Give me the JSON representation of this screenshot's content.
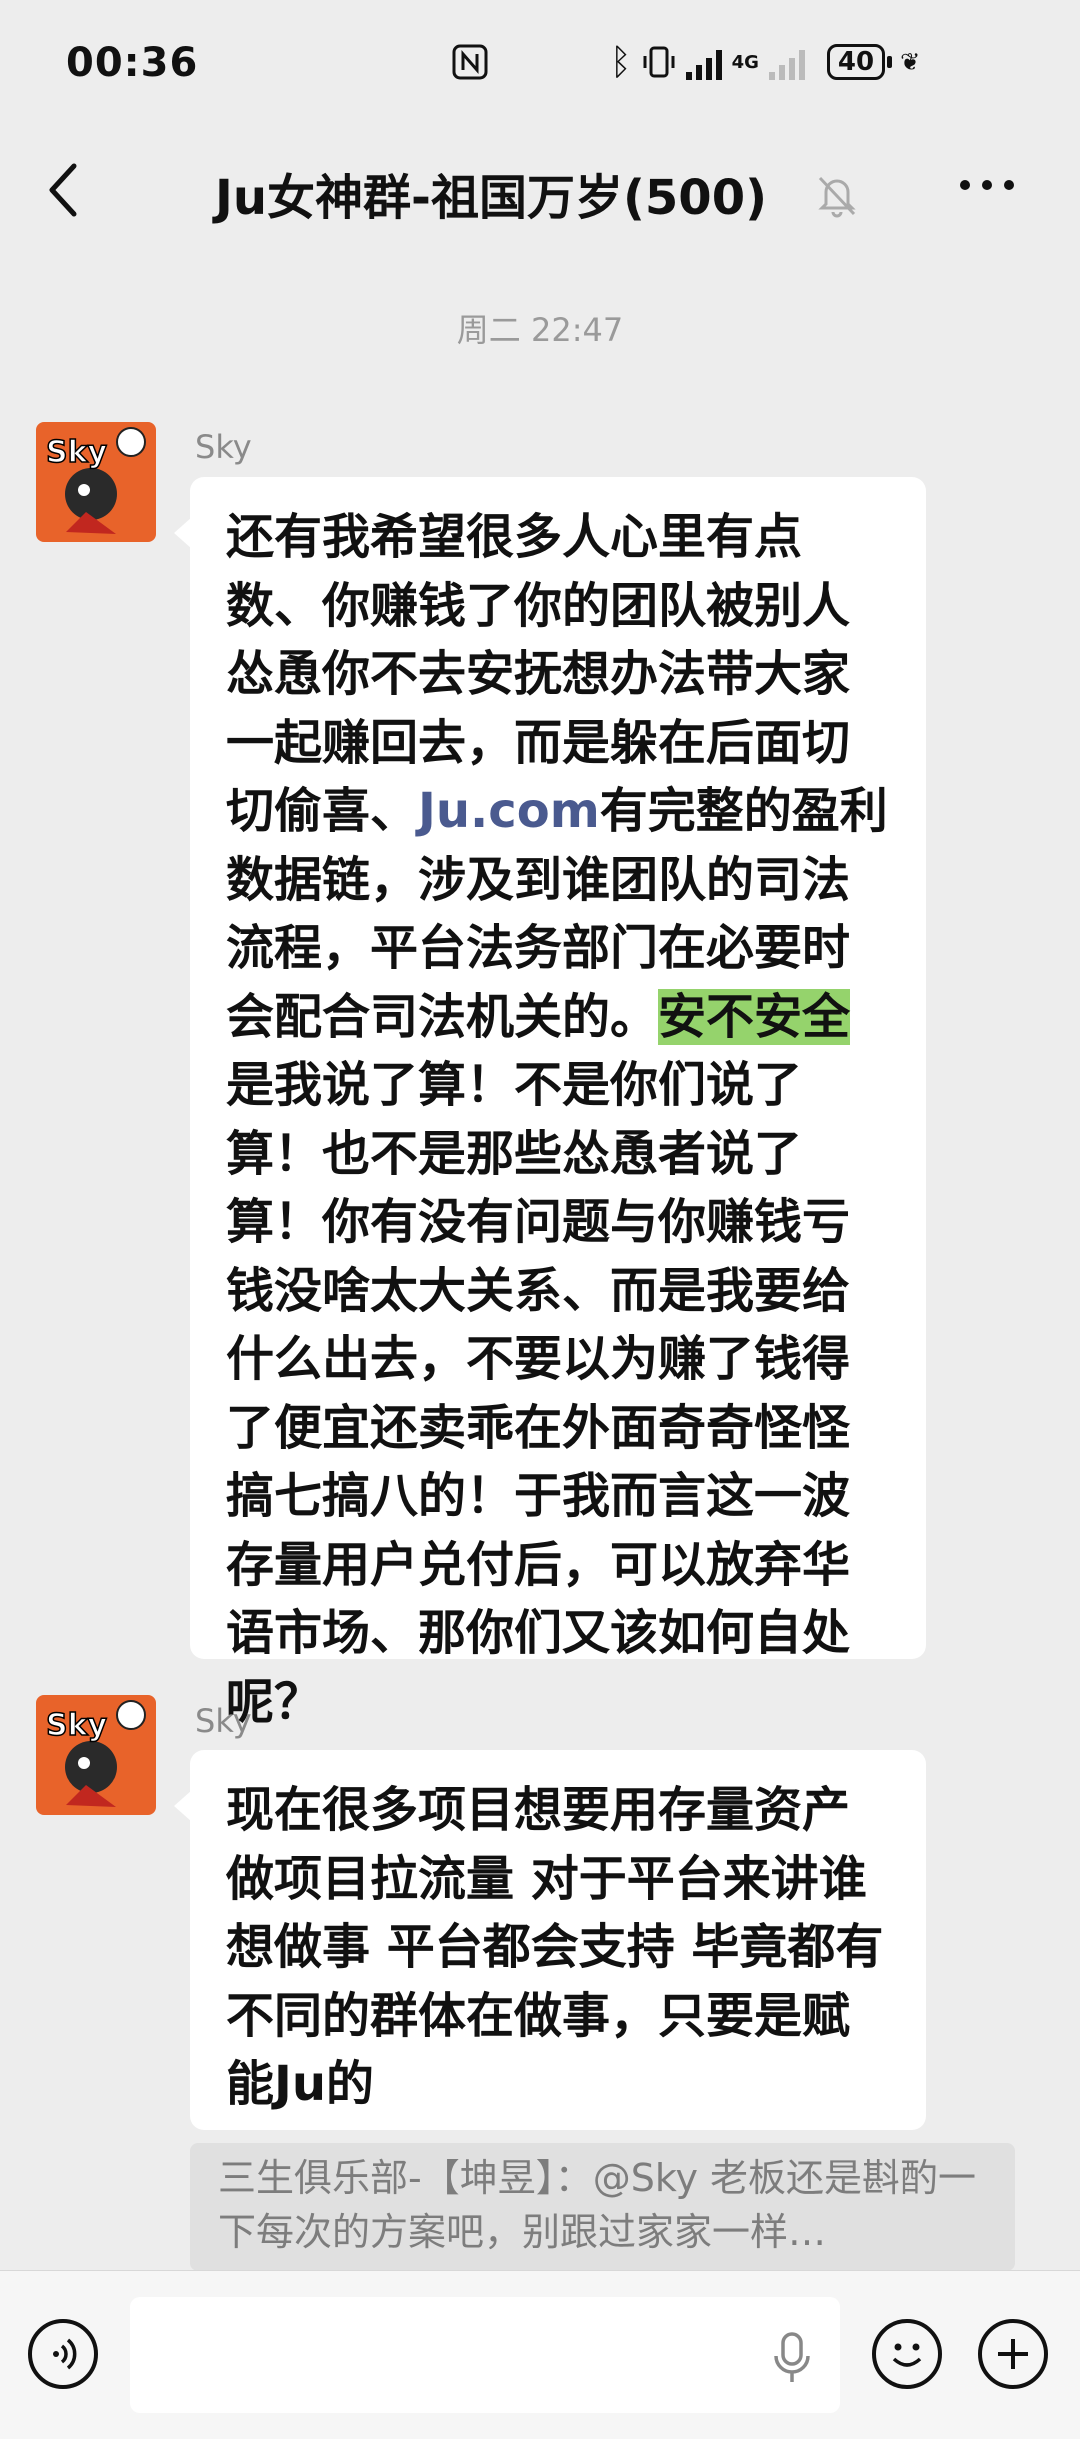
{
  "status_bar": {
    "time": "00:36",
    "network": "4G",
    "battery": "40"
  },
  "header": {
    "title": "Ju女神群-祖国万岁(500)"
  },
  "timestamp": "周二 22:47",
  "messages": [
    {
      "sender": "Sky",
      "avatar_icon": "sky-avatar",
      "text_1": "还有我希望很多人心里有点数、你赚钱了你的团队被别人怂恿你不去安抚想办法带大家一起赚回去，而是躲在后面切切偷喜、",
      "link": "Ju.com",
      "text_2": "有完整的盈利数据链，涉及到谁团队的司法流程，平台法务部门在必要时会配合司法机关的。",
      "highlight": "安不安全",
      "text_3": "是我说了算！不是你们说了算！也不是那些怂恿者说了算！你有没有问题与你赚钱亏钱没啥太大关系、而是我要给什么出去，不要以为赚了钱得了便宜还卖乖在外面奇奇怪怪搞七搞八的！于我而言这一波存量用户兑付后，可以放弃华语市场、那你们又该如何自处呢？"
    },
    {
      "sender": "Sky",
      "avatar_icon": "sky-avatar",
      "text": "现在很多项目想要用存量资产做项目拉流量 对于平台来讲谁想做事 平台都会支持 毕竟都有不同的群体在做事，只要是赋能Ju的"
    }
  ],
  "quoted_reply": "三生俱乐部-【坤昱】：@Sky 老板还是斟酌一下每次的方案吧，别跟过家家一样…",
  "colors": {
    "background": "#ededed",
    "bubble": "#ffffff",
    "highlight": "#95d36c",
    "link": "#4a5a8f"
  }
}
